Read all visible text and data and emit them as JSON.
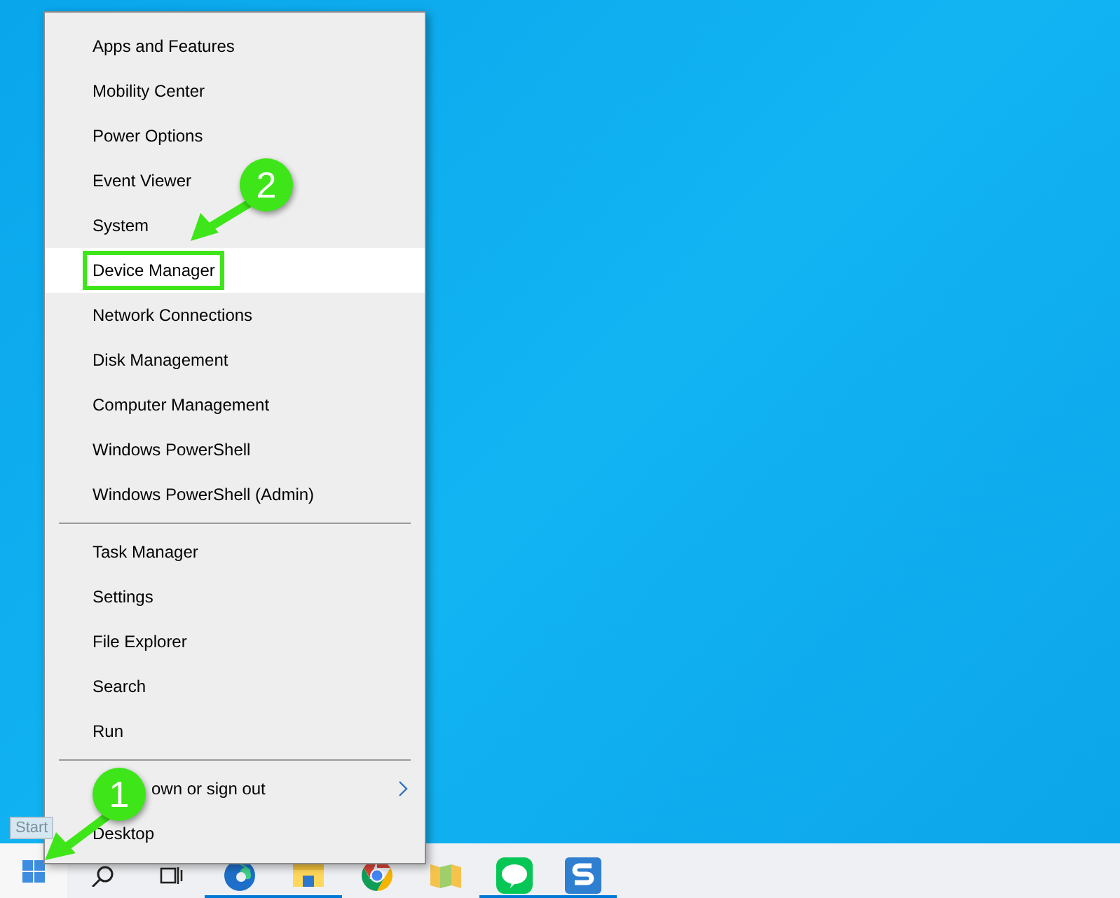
{
  "menu": {
    "groups": [
      {
        "items": [
          {
            "label": "Apps and Features",
            "selected": false,
            "kind": "plain"
          },
          {
            "label": "Mobility Center",
            "selected": false,
            "kind": "plain"
          },
          {
            "label": "Power Options",
            "selected": false,
            "kind": "plain"
          },
          {
            "label": "Event Viewer",
            "selected": false,
            "kind": "plain"
          },
          {
            "label": "System",
            "selected": false,
            "kind": "plain"
          },
          {
            "label": "Device Manager",
            "selected": true,
            "kind": "plain"
          },
          {
            "label": "Network Connections",
            "selected": false,
            "kind": "plain"
          },
          {
            "label": "Disk Management",
            "selected": false,
            "kind": "plain"
          },
          {
            "label": "Computer Management",
            "selected": false,
            "kind": "plain"
          },
          {
            "label": "Windows PowerShell",
            "selected": false,
            "kind": "plain"
          },
          {
            "label": "Windows PowerShell (Admin)",
            "selected": false,
            "kind": "plain"
          }
        ]
      },
      {
        "items": [
          {
            "label": "Task Manager",
            "selected": false,
            "kind": "plain"
          },
          {
            "label": "Settings",
            "selected": false,
            "kind": "plain"
          },
          {
            "label": "File Explorer",
            "selected": false,
            "kind": "plain"
          },
          {
            "label": "Search",
            "selected": false,
            "kind": "plain"
          },
          {
            "label": "Run",
            "selected": false,
            "kind": "plain"
          }
        ]
      },
      {
        "items": [
          {
            "label": "own or sign out",
            "selected": false,
            "kind": "submenu"
          },
          {
            "label": "Desktop",
            "selected": false,
            "kind": "plain"
          }
        ]
      }
    ]
  },
  "start_tooltip": "Start",
  "taskbar": {
    "apps": [
      {
        "kind": "search",
        "running": false
      },
      {
        "kind": "taskview",
        "running": false
      },
      {
        "kind": "edge",
        "running": true
      },
      {
        "kind": "explorer",
        "running": true
      },
      {
        "kind": "chrome",
        "running": false
      },
      {
        "kind": "folder",
        "running": false
      },
      {
        "kind": "chat",
        "running": true
      },
      {
        "kind": "snip",
        "running": true
      }
    ]
  },
  "annotations": [
    {
      "number": "1",
      "kind": "arrow"
    },
    {
      "number": "2",
      "kind": "arrow"
    }
  ]
}
